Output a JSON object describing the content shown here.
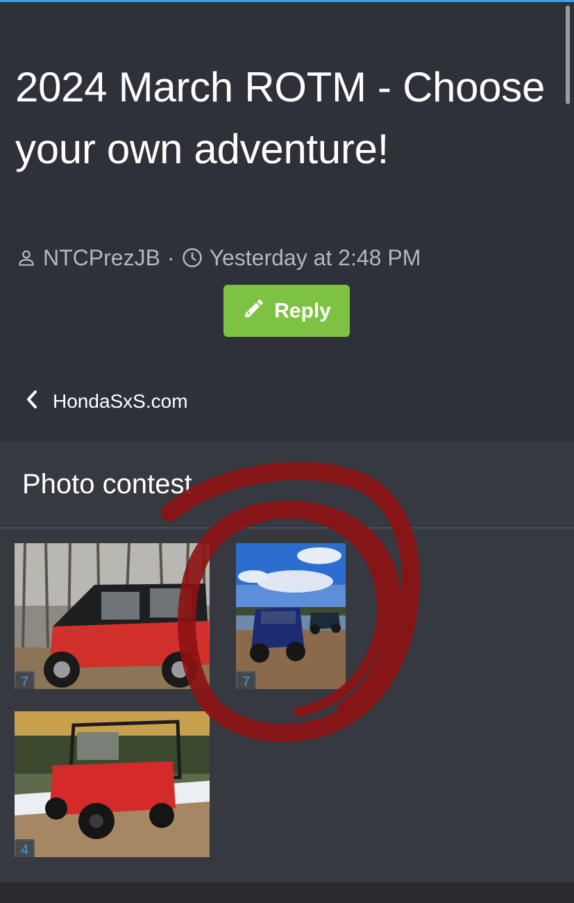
{
  "thread": {
    "title": "2024 March ROTM - Choose your own adventure!",
    "author": "NTCPrezJB",
    "separator": "·",
    "date": "Yesterday at 2:48 PM",
    "author_icon": "user-icon",
    "date_icon": "clock-icon"
  },
  "actions": {
    "reply_label": "Reply",
    "reply_icon": "pencil-icon",
    "reply_color": "#7dc242"
  },
  "breadcrumb": {
    "label": "HondaSxS.com",
    "icon": "chevron-left-icon"
  },
  "section": {
    "title": "Photo contest"
  },
  "photos": [
    {
      "subject": "red side-by-side with black cab in leafless woods",
      "count": "7"
    },
    {
      "subject": "blue side-by-side on rocky lake shore under blue sky",
      "count": "7"
    },
    {
      "subject": "red side-by-side on dirt road with snow and pines",
      "count": "4"
    }
  ],
  "annotation": {
    "kind": "hand-drawn circle",
    "color": "#8e1212"
  },
  "colors": {
    "background": "#2e3138",
    "panel": "#363940",
    "accent": "#3b9cf0",
    "muted_text": "#b4b7bd"
  }
}
